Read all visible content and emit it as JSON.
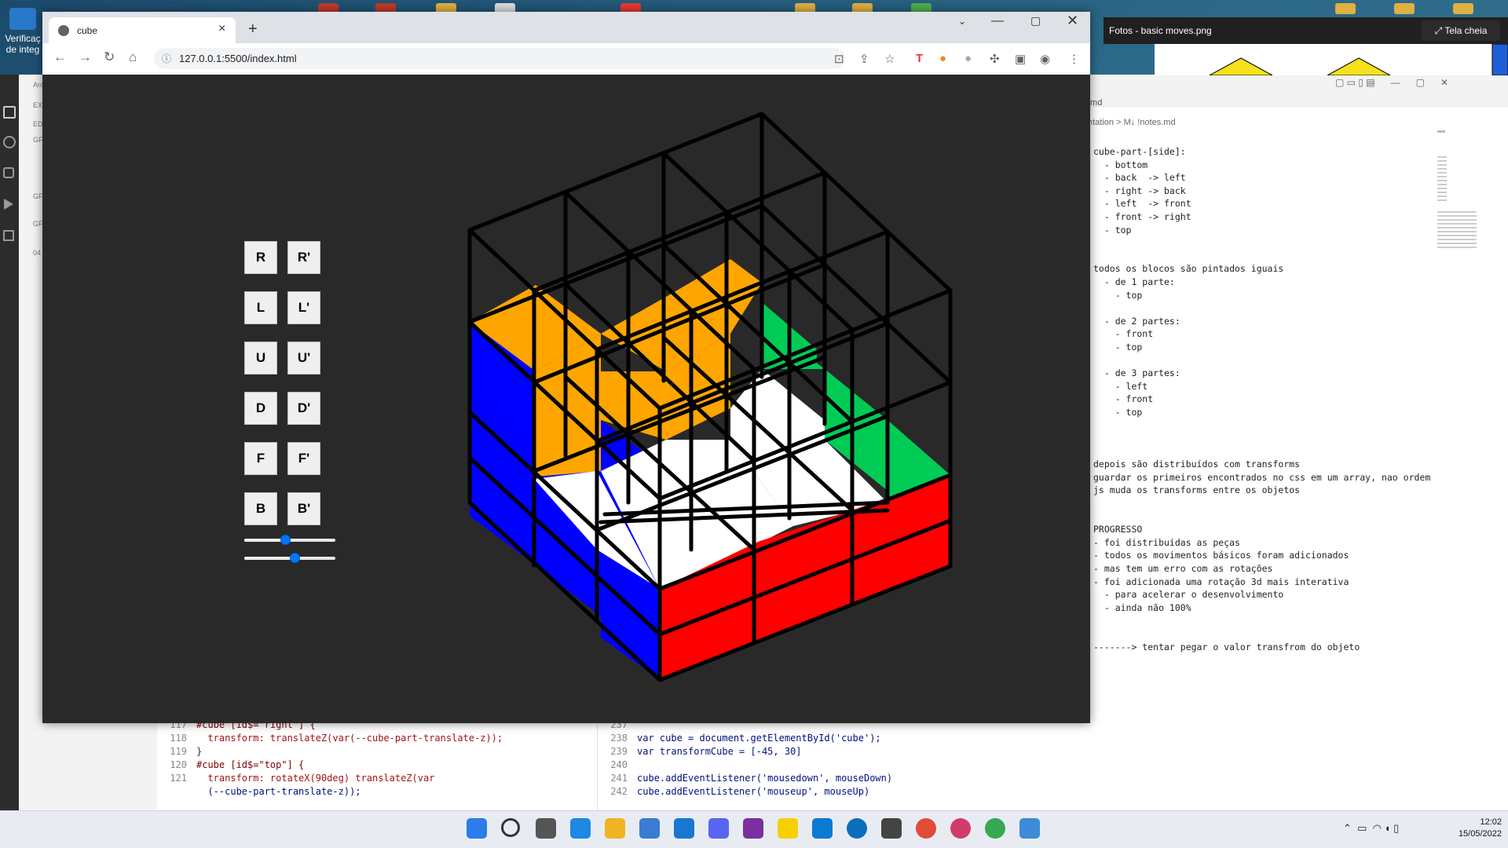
{
  "desktop": {
    "left_icon_label": "Verificação de integ...",
    "left_icon_line1": "Verificaç",
    "left_icon_line2": "de integ"
  },
  "browser": {
    "tab_title": "cube",
    "url": "127.0.0.1:5500/index.html"
  },
  "moves": [
    {
      "label": "R"
    },
    {
      "label": "R'"
    },
    {
      "label": "L"
    },
    {
      "label": "L'"
    },
    {
      "label": "U"
    },
    {
      "label": "U'"
    },
    {
      "label": "D"
    },
    {
      "label": "D'"
    },
    {
      "label": "F"
    },
    {
      "label": "F'"
    },
    {
      "label": "B"
    },
    {
      "label": "B'"
    }
  ],
  "sliders": [
    {
      "name": "rotation-x-slider",
      "value": 0.45
    },
    {
      "name": "rotation-y-slider",
      "value": 0.55
    }
  ],
  "cube_colors": {
    "left": "#0000ff",
    "top_orange": "#ffa500",
    "top_green": "#00cc55",
    "top_white": "#ffffff",
    "front": "#ff0000",
    "edge": "#000000"
  },
  "photos": {
    "title": "Fotos - basic moves.png",
    "fullscreen": "Tela cheia"
  },
  "vscode": {
    "explorer_label": "Arquiv",
    "notes_tab": ".md",
    "notes_breadcrumb": "ntation > M↓ !notes.md",
    "notes_lines": [
      "cube-part-[side]:",
      "  - bottom",
      "  - back  -> left",
      "  - right -> back",
      "  - left  -> front",
      "  - front -> right",
      "  - top",
      "",
      "",
      "todos os blocos são pintados iguais",
      "  - de 1 parte:",
      "    - top",
      "",
      "  - de 2 partes:",
      "    - front",
      "    - top",
      "",
      "  - de 3 partes:",
      "    - left",
      "    - front",
      "    - top",
      "",
      "",
      "",
      "depois são distribuídos com transforms",
      "guardar os primeiros encontrados no css em um array, nao ordem",
      "js muda os transforms entre os objetos",
      "",
      "",
      "PROGRESSO",
      "- foi distribuidas as peças",
      "- todos os movimentos básicos foram adicionados",
      "- mas tem um erro com as rotações",
      "- foi adicionada uma rotação 3d mais interativa",
      "  - para acelerar o desenvolvimento",
      "  - ainda não 100%",
      "",
      "",
      "-------> tentar pegar o valor transfrom do objeto"
    ],
    "editor1": [
      {
        "ln": "117",
        "code": "#cube [id$=\"right\"] {"
      },
      {
        "ln": "118",
        "code": "  transform: translateZ(var(--cube-part-translate-z));"
      },
      {
        "ln": "119",
        "code": "}"
      },
      {
        "ln": "120",
        "code": "#cube [id$=\"top\"] {"
      },
      {
        "ln": "121",
        "code": "  transform: rotateX(90deg) translateZ(var"
      },
      {
        "ln": "",
        "code": "  (--cube-part-translate-z));"
      }
    ],
    "editor2": [
      {
        "ln": "237",
        "code": ""
      },
      {
        "ln": "238",
        "code": "var cube = document.getElementById('cube');"
      },
      {
        "ln": "239",
        "code": "var transformCube = [-45, 30]"
      },
      {
        "ln": "240",
        "code": ""
      },
      {
        "ln": "241",
        "code": "cube.addEventListener('mousedown', mouseDown)"
      },
      {
        "ln": "242",
        "code": "cube.addEventListener('mouseup', mouseUp)"
      }
    ]
  },
  "taskbar": {
    "time": "12:02",
    "date": "15/05/2022"
  }
}
